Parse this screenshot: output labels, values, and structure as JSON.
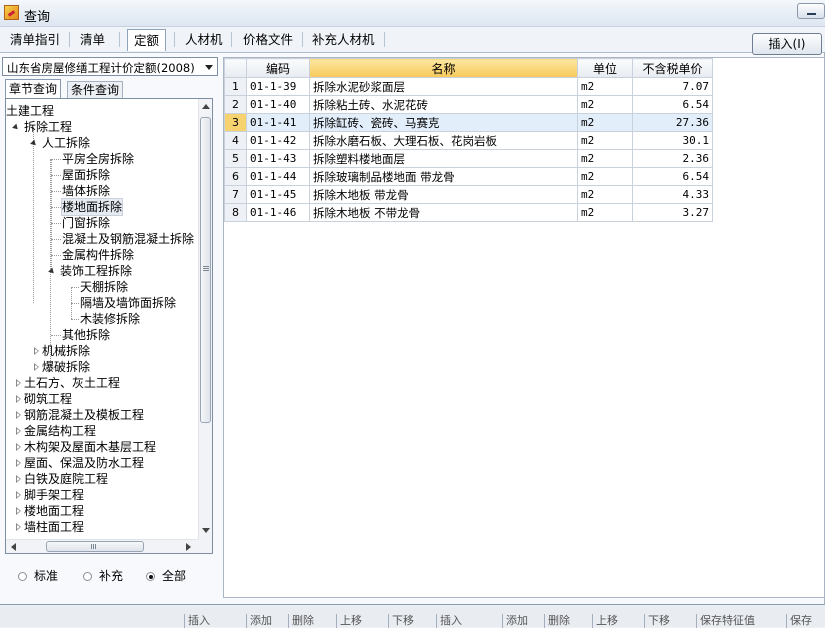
{
  "window": {
    "title": "查询"
  },
  "tabs": [
    "清单指引",
    "清单",
    "定额",
    "人材机",
    "价格文件",
    "补充人材机"
  ],
  "active_tab": "定额",
  "insert_button": "插入(I)",
  "left": {
    "dropdown_value": "山东省房屋修缮工程计价定额(2008)",
    "subtabs": [
      "章节查询",
      "条件查询"
    ],
    "tree": [
      {
        "label": "土建工程"
      },
      {
        "label": "拆除工程"
      },
      {
        "label": "人工拆除"
      },
      {
        "label": "平房全房拆除"
      },
      {
        "label": "屋面拆除"
      },
      {
        "label": "墙体拆除"
      },
      {
        "label": "楼地面拆除"
      },
      {
        "label": "门窗拆除"
      },
      {
        "label": "混凝土及钢筋混凝土拆除"
      },
      {
        "label": "金属构件拆除"
      },
      {
        "label": "装饰工程拆除"
      },
      {
        "label": "天棚拆除"
      },
      {
        "label": "隔墙及墙饰面拆除"
      },
      {
        "label": "木装修拆除"
      },
      {
        "label": "其他拆除"
      },
      {
        "label": "机械拆除"
      },
      {
        "label": "爆破拆除"
      },
      {
        "label": "土石方、灰土工程"
      },
      {
        "label": "砌筑工程"
      },
      {
        "label": "钢筋混凝土及模板工程"
      },
      {
        "label": "金属结构工程"
      },
      {
        "label": "木构架及屋面木基层工程"
      },
      {
        "label": "屋面、保温及防水工程"
      },
      {
        "label": "白铁及庭院工程"
      },
      {
        "label": "脚手架工程"
      },
      {
        "label": "楼地面工程"
      },
      {
        "label": "墙柱面工程"
      }
    ],
    "radios": [
      "标准",
      "补充",
      "全部"
    ],
    "radio_selected": "全部"
  },
  "grid": {
    "columns": [
      "编码",
      "名称",
      "单位",
      "不含税单价"
    ],
    "rows": [
      {
        "no": "1",
        "code": "01-1-39",
        "name": "拆除水泥砂浆面层",
        "unit": "m2",
        "price": "7.07"
      },
      {
        "no": "2",
        "code": "01-1-40",
        "name": "拆除粘土砖、水泥花砖",
        "unit": "m2",
        "price": "6.54"
      },
      {
        "no": "3",
        "code": "01-1-41",
        "name": "拆除缸砖、瓷砖、马赛克",
        "unit": "m2",
        "price": "27.36"
      },
      {
        "no": "4",
        "code": "01-1-42",
        "name": "拆除水磨石板、大理石板、花岗岩板",
        "unit": "m2",
        "price": "30.1"
      },
      {
        "no": "5",
        "code": "01-1-43",
        "name": "拆除塑料楼地面层",
        "unit": "m2",
        "price": "2.36"
      },
      {
        "no": "6",
        "code": "01-1-44",
        "name": "拆除玻璃制品楼地面 带龙骨",
        "unit": "m2",
        "price": "6.54"
      },
      {
        "no": "7",
        "code": "01-1-45",
        "name": "拆除木地板 带龙骨",
        "unit": "m2",
        "price": "4.33"
      },
      {
        "no": "8",
        "code": "01-1-46",
        "name": "拆除木地板 不带龙骨",
        "unit": "m2",
        "price": "3.27"
      }
    ]
  },
  "bottom_bar": [
    "插入",
    "添加",
    "删除",
    "上移",
    "下移",
    "插入",
    "添加",
    "删除",
    "上移",
    "下移",
    "保存特征值",
    "保存"
  ]
}
